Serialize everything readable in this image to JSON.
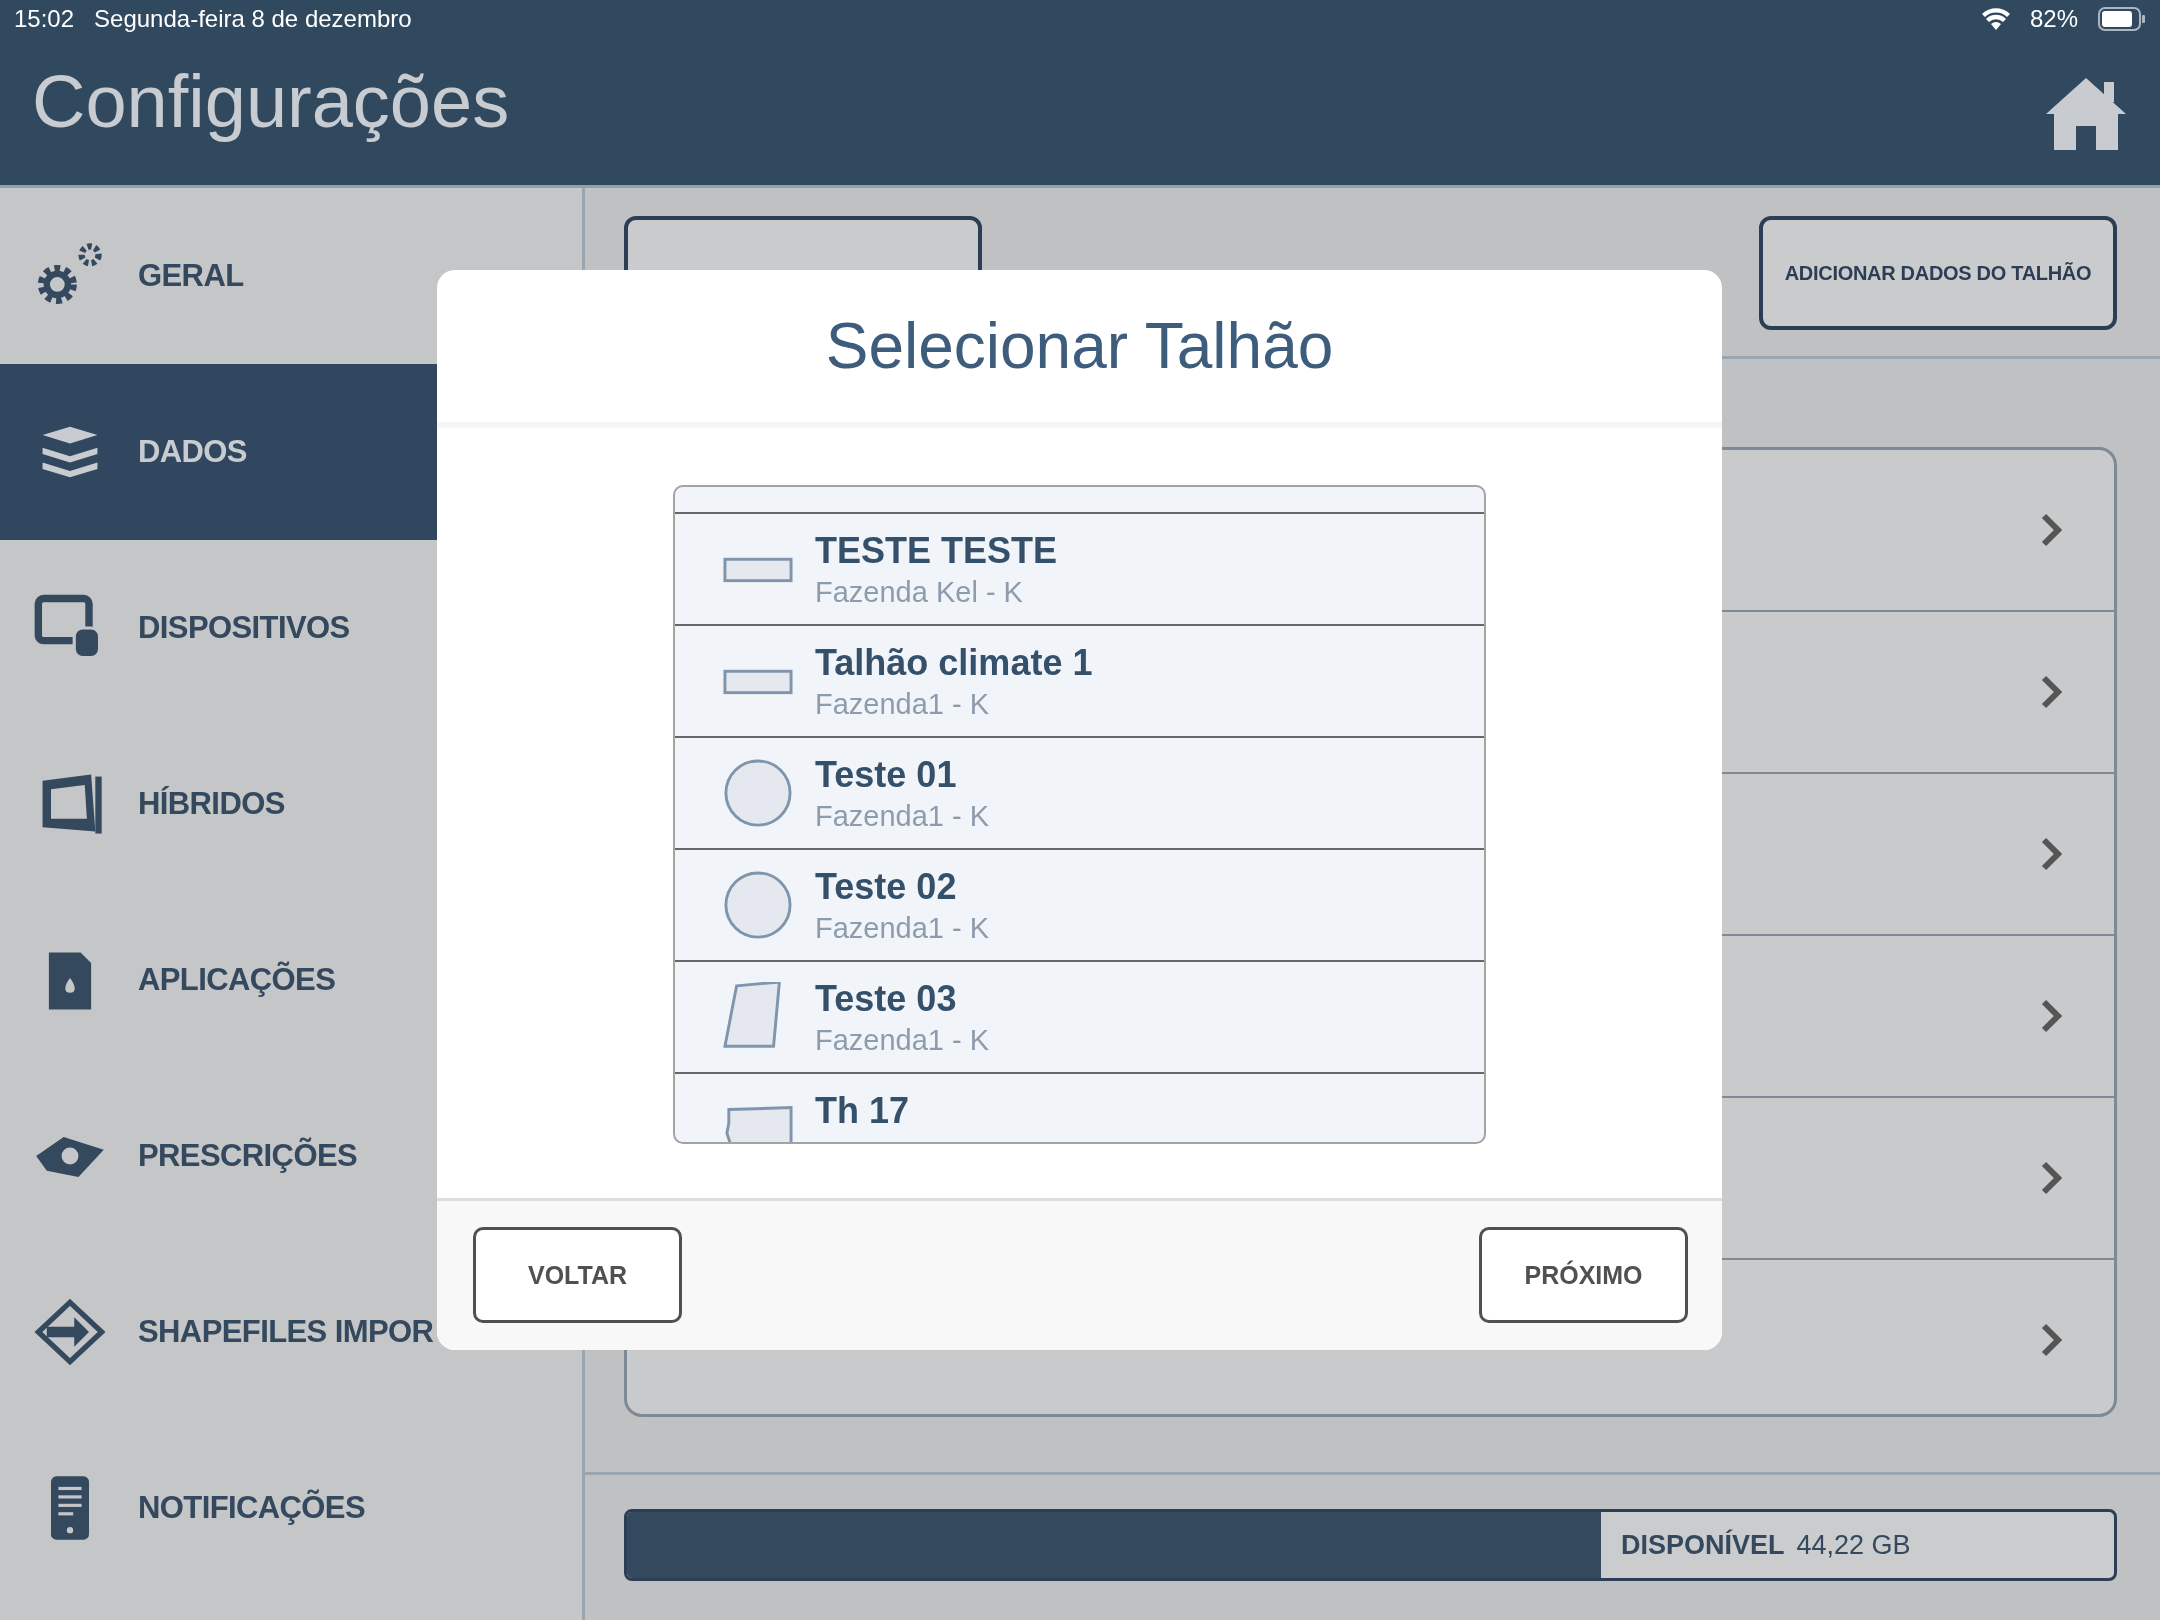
{
  "status_bar": {
    "time": "15:02",
    "date": "Segunda-feira 8 de dezembro",
    "battery": "82%"
  },
  "header": {
    "title": "Configurações"
  },
  "sidebar": {
    "items": [
      {
        "label": "GERAL",
        "selected": false
      },
      {
        "label": "DADOS",
        "selected": true
      },
      {
        "label": "DISPOSITIVOS",
        "selected": false
      },
      {
        "label": "HÍBRIDOS",
        "selected": false
      },
      {
        "label": "APLICAÇÕES",
        "selected": false
      },
      {
        "label": "PRESCRIÇÕES",
        "selected": false
      },
      {
        "label": "SHAPEFILES IMPOR",
        "selected": false
      },
      {
        "label": "NOTIFICAÇÕES",
        "selected": false
      }
    ]
  },
  "content": {
    "add_button": "ADICIONAR DADOS DO TALHÃO",
    "panel_rows": [
      {
        "kind": "chevron"
      },
      {
        "kind": "chevron"
      },
      {
        "kind": "chevron"
      },
      {
        "kind": "chevron"
      },
      {
        "kind": "chevron"
      },
      {
        "kind": "chevron"
      }
    ],
    "storage": {
      "label": "DISPONÍVEL",
      "value": "44,22 GB",
      "level": 0.655
    }
  },
  "dialog": {
    "title": "Selecionar Talhão",
    "fields": [
      {
        "name": "TESTE TESTE",
        "farm": "Fazenda Kel - K",
        "kind": "rectangle"
      },
      {
        "name": "Talhão climate 1",
        "farm": "Fazenda1 - K",
        "kind": "rectangle"
      },
      {
        "name": "Teste 01",
        "farm": "Fazenda1 - K",
        "kind": "circle"
      },
      {
        "name": "Teste 02",
        "farm": "Fazenda1 - K",
        "kind": "circle"
      },
      {
        "name": "Teste 03",
        "farm": "Fazenda1 - K",
        "kind": "quad"
      },
      {
        "name": "Th 17",
        "kind": "polygon"
      }
    ],
    "back_button": "VOLTAR",
    "next_button": "PRÓXIMO"
  }
}
